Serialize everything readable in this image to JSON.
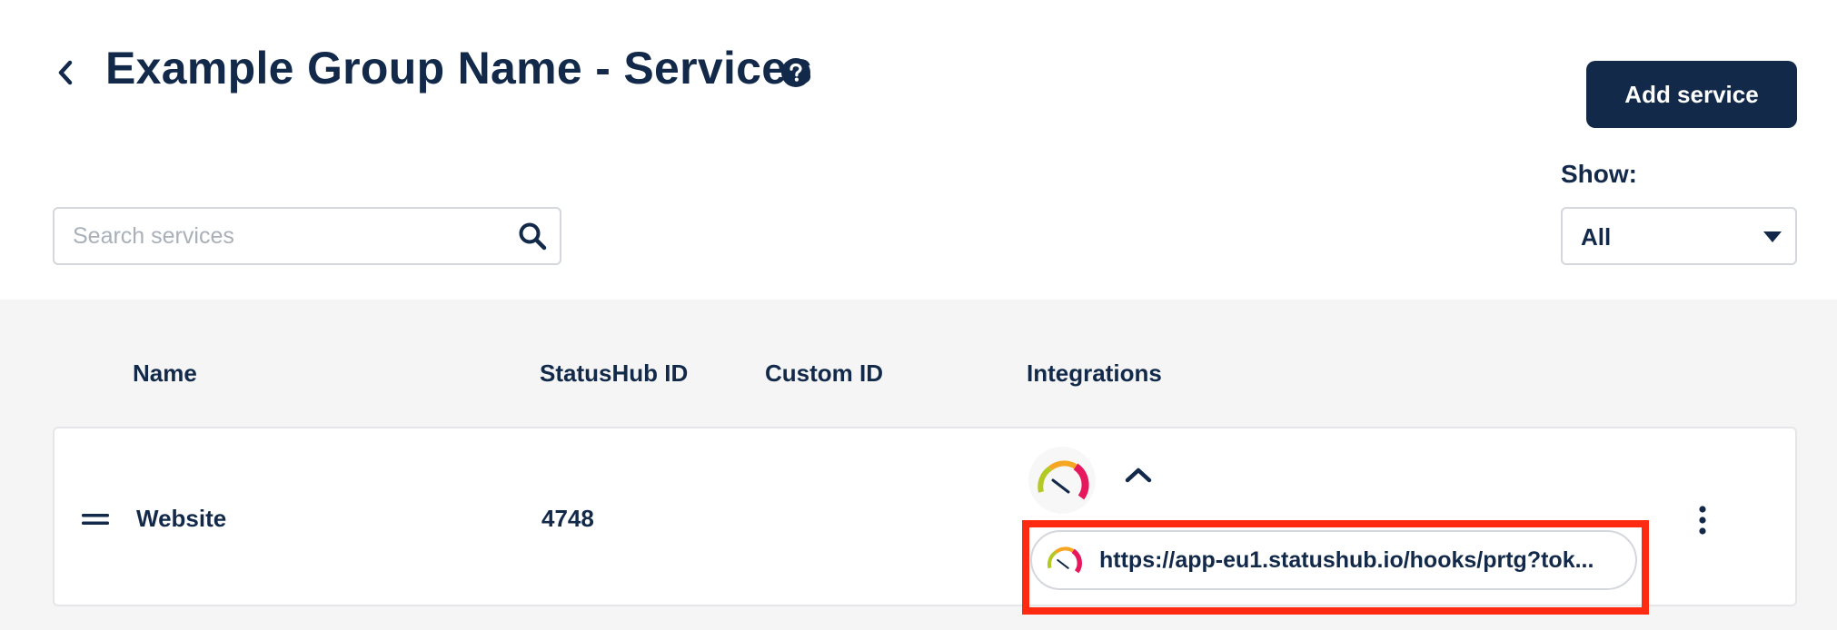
{
  "header": {
    "title": "Example Group Name - Services",
    "add_button_label": "Add service"
  },
  "search": {
    "placeholder": "Search services",
    "value": ""
  },
  "filter": {
    "label": "Show:",
    "selected": "All"
  },
  "table": {
    "columns": [
      "Name",
      "StatusHub ID",
      "Custom ID",
      "Integrations"
    ],
    "rows": [
      {
        "name": "Website",
        "statushub_id": "4748",
        "custom_id": "",
        "integration_url": "https://app-eu1.statushub.io/hooks/prtg?tok..."
      }
    ]
  },
  "icons": {
    "back": "chevron-left-icon",
    "help": "question-circle-icon",
    "search": "search-icon",
    "dropdown": "caret-down-icon",
    "drag": "drag-handle-icon",
    "integration": "prtg-gauge-icon",
    "collapse": "chevron-up-icon",
    "more": "kebab-icon"
  },
  "colors": {
    "primary": "#12294a",
    "background_table": "#f5f5f5",
    "highlight": "#ff2a12",
    "gauge_green": "#b5c925",
    "gauge_orange": "#f5a623",
    "gauge_pink": "#e6175c"
  }
}
